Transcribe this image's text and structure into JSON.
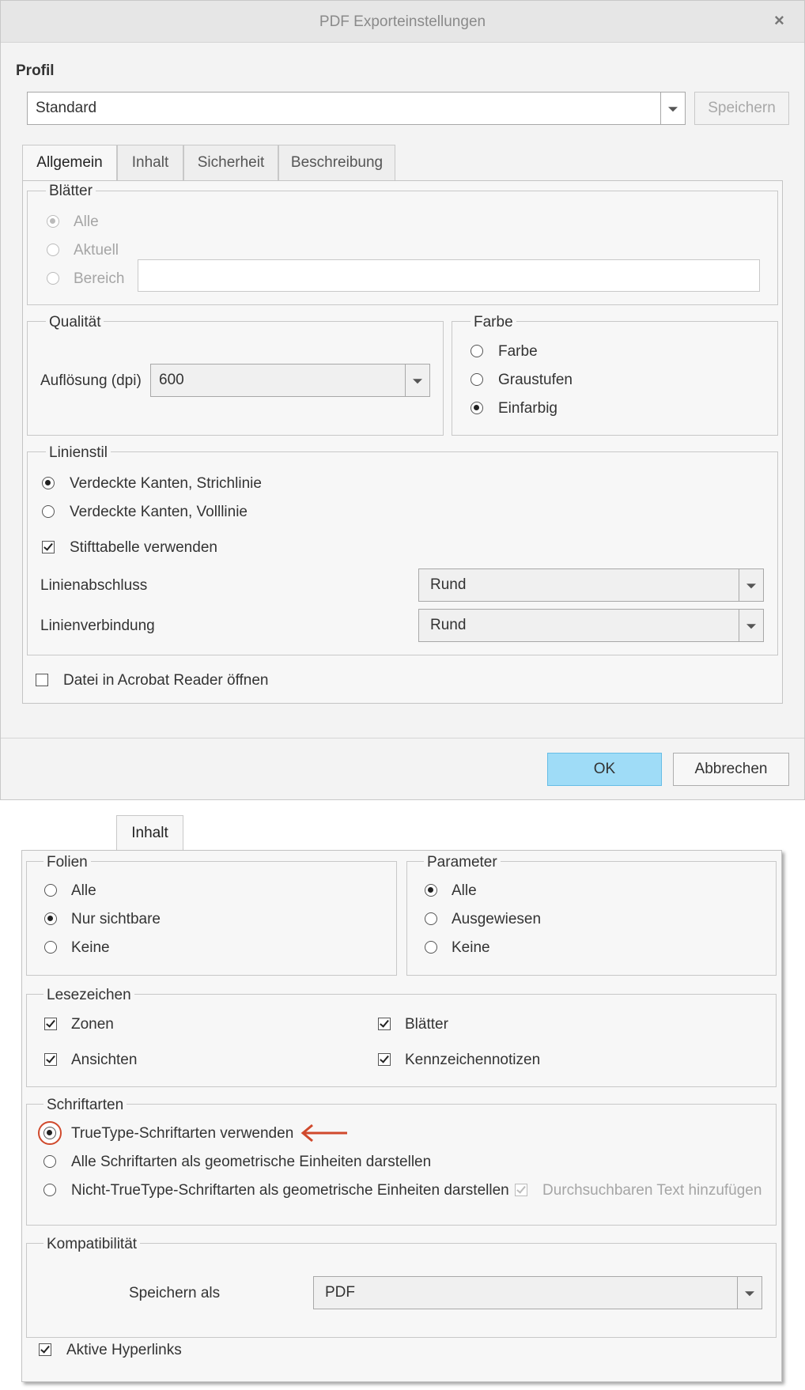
{
  "dialog": {
    "title": "PDF Exporteinstellungen",
    "close_icon": "×",
    "profile": {
      "label": "Profil",
      "selected": "Standard",
      "save_button": "Speichern"
    },
    "tabs": [
      "Allgemein",
      "Inhalt",
      "Sicherheit",
      "Beschreibung"
    ],
    "active_tab": "Allgemein",
    "blaetter": {
      "legend": "Blätter",
      "options": [
        "Alle",
        "Aktuell",
        "Bereich"
      ],
      "selected": "Alle",
      "range_value": ""
    },
    "qualitaet": {
      "legend": "Qualität",
      "resolution_label": "Auflösung (dpi)",
      "resolution_value": "600"
    },
    "farbe": {
      "legend": "Farbe",
      "options": [
        "Farbe",
        "Graustufen",
        "Einfarbig"
      ],
      "selected": "Einfarbig"
    },
    "linienstil": {
      "legend": "Linienstil",
      "options": [
        "Verdeckte Kanten, Strichlinie",
        "Verdeckte Kanten, Volllinie"
      ],
      "selected": "Verdeckte Kanten, Strichlinie",
      "pen_table_label": "Stifttabelle verwenden",
      "pen_table_checked": true,
      "line_cap_label": "Linienabschluss",
      "line_cap_value": "Rund",
      "line_join_label": "Linienverbindung",
      "line_join_value": "Rund"
    },
    "open_in_acrobat_label": "Datei in Acrobat Reader öffnen",
    "open_in_acrobat_checked": false,
    "ok_button": "OK",
    "cancel_button": "Abbrechen"
  },
  "inhalt_panel": {
    "tab_label": "Inhalt",
    "folien": {
      "legend": "Folien",
      "options": [
        "Alle",
        "Nur sichtbare",
        "Keine"
      ],
      "selected": "Nur sichtbare"
    },
    "parameter": {
      "legend": "Parameter",
      "options": [
        "Alle",
        "Ausgewiesen",
        "Keine"
      ],
      "selected": "Alle"
    },
    "lesezeichen": {
      "legend": "Lesezeichen",
      "items": [
        "Zonen",
        "Blätter",
        "Ansichten",
        "Kennzeichennotizen"
      ],
      "all_checked": true
    },
    "schriftarten": {
      "legend": "Schriftarten",
      "options": [
        "TrueType-Schriftarten verwenden",
        "Alle Schriftarten als geometrische Einheiten darstellen",
        "Nicht-TrueType-Schriftarten als geometrische Einheiten darstellen"
      ],
      "selected": "TrueType-Schriftarten verwenden",
      "searchable_text_label": "Durchsuchbaren Text hinzufügen",
      "searchable_text_checked": true,
      "searchable_text_disabled": true,
      "highlight_color": "#d0492c"
    },
    "kompatibilitaet": {
      "legend": "Kompatibilität",
      "save_as_label": "Speichern als",
      "save_as_value": "PDF"
    },
    "active_hyperlinks_label": "Aktive Hyperlinks",
    "active_hyperlinks_checked": true
  },
  "colors": {
    "primary_button": "#9fdcf7",
    "annotation_arrow": "#d0492c"
  }
}
